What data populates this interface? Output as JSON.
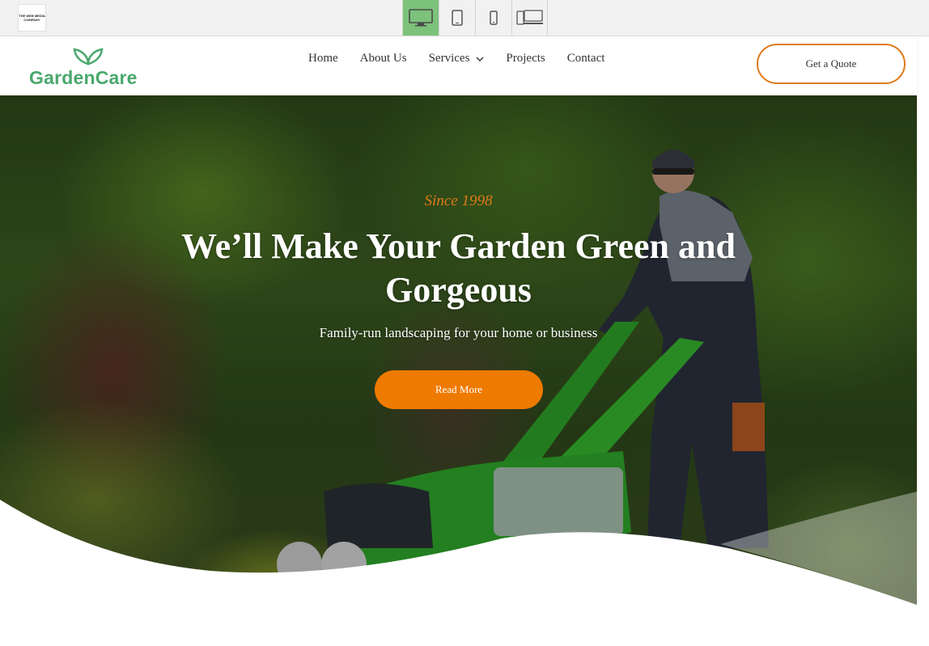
{
  "topbar": {
    "brand_line1": "THE WEB MEDIA",
    "brand_line2": "COMPANY",
    "devices": [
      {
        "icon": "desktop-icon",
        "active": true
      },
      {
        "icon": "tablet-icon",
        "active": false
      },
      {
        "icon": "mobile-icon",
        "active": false
      },
      {
        "icon": "multi-device-icon",
        "active": false
      }
    ]
  },
  "header": {
    "logo": "GardenCare",
    "nav": {
      "home": "Home",
      "about": "About Us",
      "services": "Services",
      "projects": "Projects",
      "contact": "Contact"
    },
    "quote_button": "Get a Quote"
  },
  "hero": {
    "since": "Since 1998",
    "title": "We’ll Make Your Garden Green and Gorgeous",
    "subtitle": "Family-run landscaping for your home or business",
    "cta": "Read More"
  },
  "colors": {
    "brand_green": "#4aa86c",
    "accent_orange": "#ef7a00",
    "active_device": "#7cc27b"
  }
}
